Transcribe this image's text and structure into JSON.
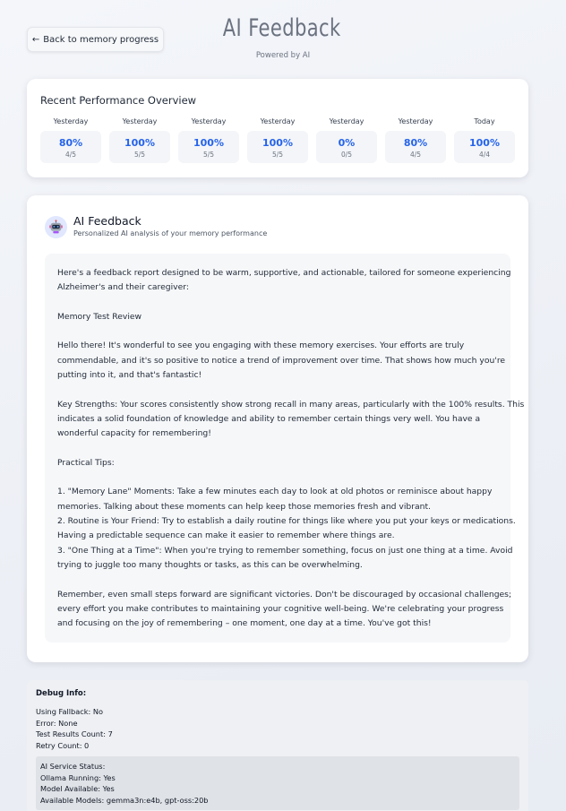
{
  "header": {
    "back_label": "Back to memory progress",
    "title": "AI Feedback",
    "subtitle": "Powered by AI"
  },
  "performance": {
    "title": "Recent Performance Overview",
    "items": [
      {
        "label": "Yesterday",
        "percent": "80%",
        "count": "4/5"
      },
      {
        "label": "Yesterday",
        "percent": "100%",
        "count": "5/5"
      },
      {
        "label": "Yesterday",
        "percent": "100%",
        "count": "5/5"
      },
      {
        "label": "Yesterday",
        "percent": "100%",
        "count": "5/5"
      },
      {
        "label": "Yesterday",
        "percent": "0%",
        "count": "0/5"
      },
      {
        "label": "Yesterday",
        "percent": "80%",
        "count": "4/5"
      },
      {
        "label": "Today",
        "percent": "100%",
        "count": "4/4"
      }
    ]
  },
  "feedback": {
    "title": "AI Feedback",
    "subtitle": "Personalized AI analysis of your memory performance",
    "lines": [
      "Here's a feedback report designed to be warm, supportive, and actionable, tailored for someone experiencing",
      "Alzheimer's and their caregiver:",
      "",
      "Memory Test Review",
      "",
      "Hello there! It's wonderful to see you engaging with these memory exercises. Your efforts are truly",
      "commendable, and it's so positive to notice a trend of improvement over time. That shows how much you're",
      "putting into it, and that's fantastic!",
      "",
      "Key Strengths: Your scores consistently show strong recall in many areas, particularly with the 100% results. This",
      "indicates a solid foundation of knowledge and ability to remember certain things very well. You have a",
      "wonderful capacity for remembering!",
      "",
      "Practical Tips:",
      "",
      "1. \"Memory Lane\" Moments: Take a few minutes each day to look at old photos or reminisce about happy",
      "memories. Talking about these moments can help keep those memories fresh and vibrant.",
      "2. Routine is Your Friend: Try to establish a daily routine for things like where you put your keys or medications.",
      "Having a predictable sequence can make it easier to remember where things are.",
      "3. \"One Thing at a Time\": When you're trying to remember something, focus on just one thing at a time. Avoid",
      "trying to juggle too many thoughts or tasks, as this can be overwhelming.",
      "",
      "Remember, even small steps forward are significant victories.  Don't be discouraged by occasional challenges;",
      "every effort you make contributes to maintaining your cognitive well-being.  We're celebrating your progress",
      "and focusing on the joy of remembering – one moment, one day at a time. You've got this!"
    ]
  },
  "debug": {
    "title": "Debug Info:",
    "lines": [
      "Using Fallback: No",
      "Error: None",
      "Test Results Count: 7",
      "Retry Count: 0"
    ],
    "service": [
      "AI Service Status:",
      "Ollama Running: Yes",
      "Model Available: Yes",
      "Available Models: gemma3n:e4b, gpt-oss:20b"
    ]
  },
  "colors": {
    "accent": "#2563eb",
    "avatar_bg": "#e0e7ff"
  },
  "icons": {
    "back": "left-arrow",
    "avatar": "robot-icon"
  }
}
